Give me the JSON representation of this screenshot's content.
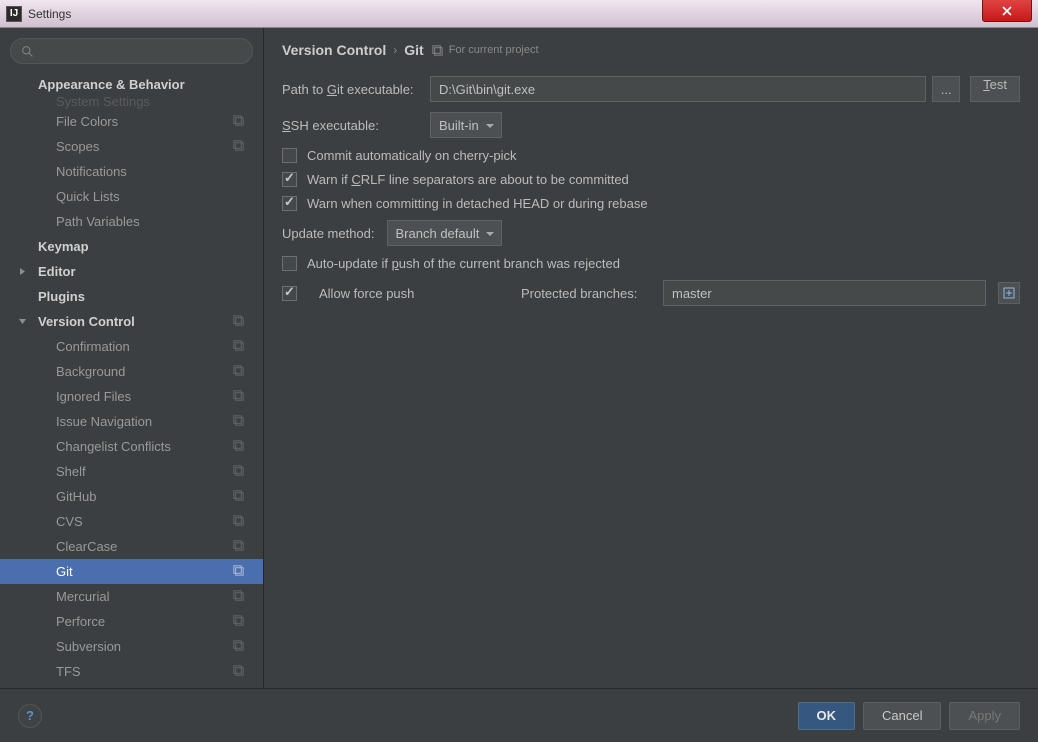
{
  "window": {
    "title": "Settings"
  },
  "breadcrumb": {
    "part1": "Version Control",
    "part2": "Git",
    "scope": "For current project"
  },
  "sidebar": {
    "truncated_top": "System Settings",
    "cat_appearance": "Appearance & Behavior",
    "items_top": [
      {
        "label": "File Colors",
        "copy": true
      },
      {
        "label": "Scopes",
        "copy": true
      },
      {
        "label": "Notifications",
        "copy": false
      },
      {
        "label": "Quick Lists",
        "copy": false
      },
      {
        "label": "Path Variables",
        "copy": false
      }
    ],
    "keymap": "Keymap",
    "editor": "Editor",
    "plugins": "Plugins",
    "vc": "Version Control",
    "vc_items": [
      {
        "label": "Confirmation",
        "copy": true
      },
      {
        "label": "Background",
        "copy": true
      },
      {
        "label": "Ignored Files",
        "copy": true
      },
      {
        "label": "Issue Navigation",
        "copy": true
      },
      {
        "label": "Changelist Conflicts",
        "copy": true
      },
      {
        "label": "Shelf",
        "copy": true
      },
      {
        "label": "GitHub",
        "copy": true
      },
      {
        "label": "CVS",
        "copy": true
      },
      {
        "label": "ClearCase",
        "copy": true
      },
      {
        "label": "Git",
        "copy": true,
        "selected": true
      },
      {
        "label": "Mercurial",
        "copy": true
      },
      {
        "label": "Perforce",
        "copy": true
      },
      {
        "label": "Subversion",
        "copy": true
      },
      {
        "label": "TFS",
        "copy": true
      }
    ]
  },
  "form": {
    "path_label_pre": "Path to ",
    "path_label_u": "G",
    "path_label_post": "it executable:",
    "path_value": "D:\\Git\\bin\\git.exe",
    "browse": "...",
    "test_u": "T",
    "test_post": "est",
    "ssh_u": "S",
    "ssh_post": "SH executable:",
    "ssh_value": "Built-in",
    "chk1": "Commit automatically on cherry-pick",
    "chk2_pre": "Warn if ",
    "chk2_u": "C",
    "chk2_post": "RLF line separators are about to be committed",
    "chk3": "Warn when committing in detached HEAD or during rebase",
    "update_label": "Update method:",
    "update_value": "Branch default",
    "chk4_pre": "Auto-update if ",
    "chk4_u": "p",
    "chk4_post": "ush of the current branch was rejected",
    "chk5": "Allow force push",
    "pb_label": "Protected branches:",
    "pb_value": "master"
  },
  "footer": {
    "ok": "OK",
    "cancel": "Cancel",
    "apply": "Apply",
    "help": "?"
  }
}
